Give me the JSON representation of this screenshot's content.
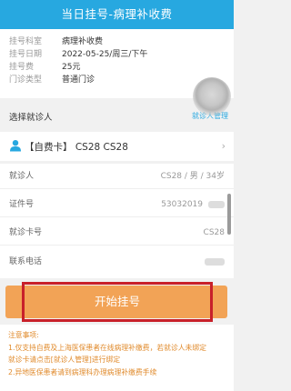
{
  "header": {
    "title": "当日挂号-病理补收费"
  },
  "info": {
    "rows": [
      {
        "label": "挂号科室",
        "value": "病理补收费"
      },
      {
        "label": "挂号日期",
        "value": "2022-05-25/周三/下午"
      },
      {
        "label": "挂号费",
        "value": "25元"
      },
      {
        "label": "门诊类型",
        "value": "普通门诊"
      }
    ]
  },
  "patient_section": {
    "title": "选择就诊人",
    "manage_link": "就诊人管理"
  },
  "card": {
    "text": "【自费卡】 CS28 CS28"
  },
  "details": {
    "patient_label": "就诊人",
    "patient_value": "CS28 / 男 / 34岁",
    "id_label": "证件号",
    "id_value": "53032019",
    "card_label": "就诊卡号",
    "card_value": "CS28",
    "phone_label": "联系电话"
  },
  "action": {
    "label": "开始挂号"
  },
  "notes": {
    "title": "注意事项:",
    "items": [
      "1.仅支持自费及上海医保患者在线病理补缴费，若就诊人未绑定",
      "就诊卡请点击[就诊人管理]进行绑定",
      "2.异地医保患者请到病理科办理病理补缴费手续"
    ]
  },
  "colors": {
    "header": "#27a8e0",
    "button": "#f2a356",
    "highlight": "#c8202a",
    "notes": "#e08a2b"
  }
}
